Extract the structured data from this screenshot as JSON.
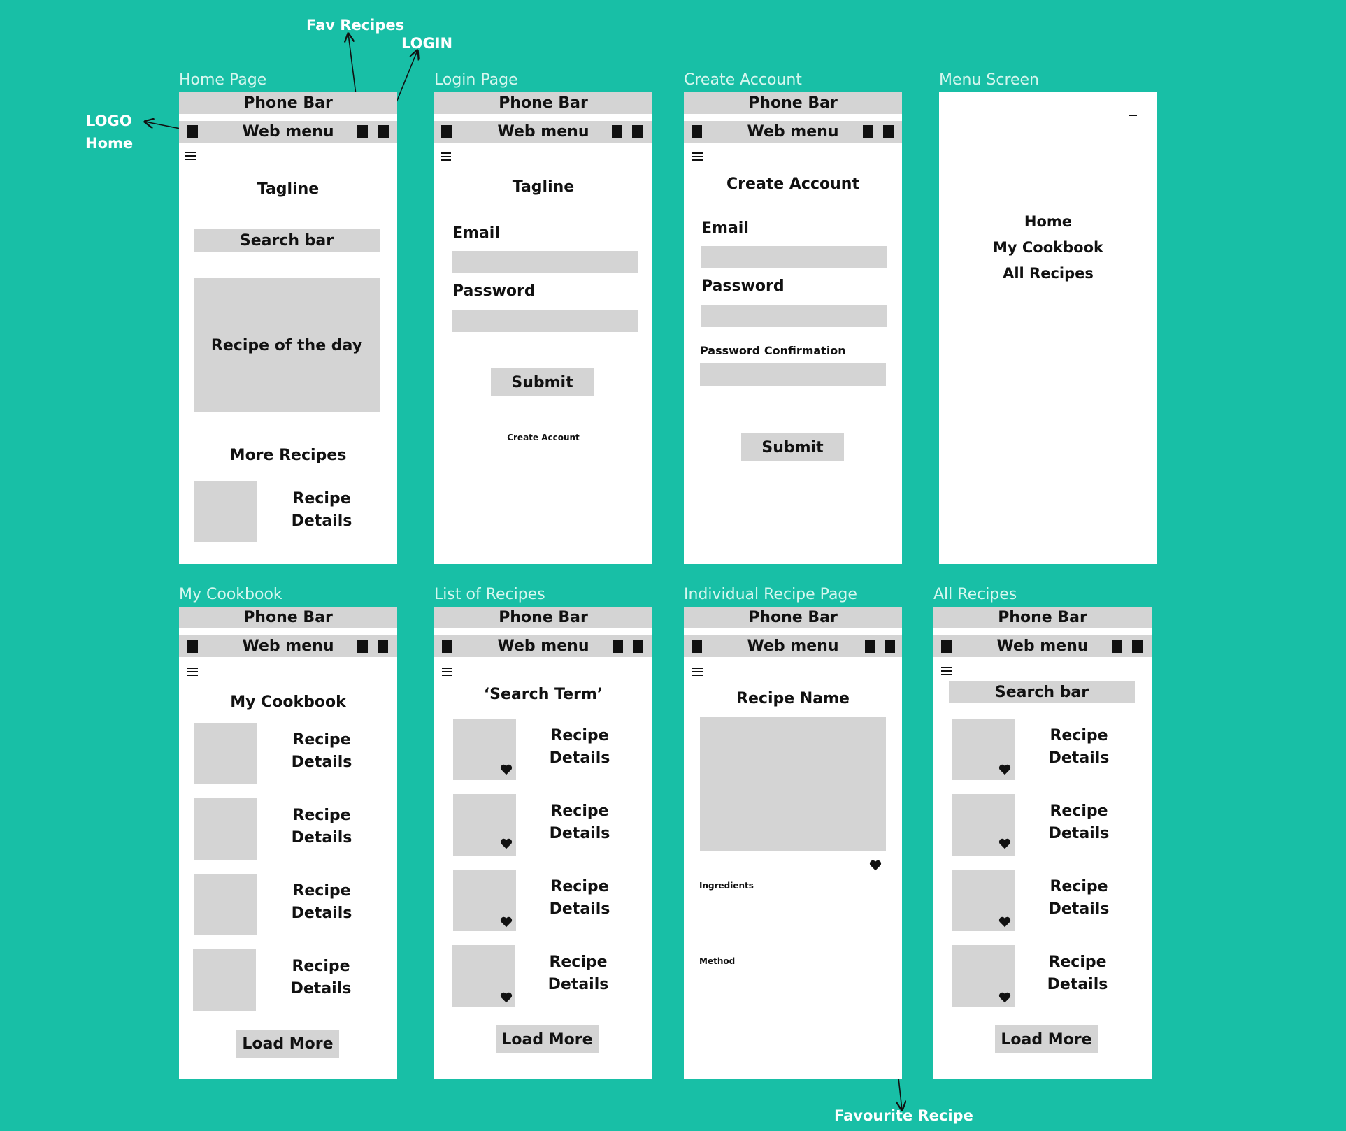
{
  "annotations": {
    "fav_recipes": "Fav Recipes",
    "login": "LOGIN",
    "logo": "LOGO",
    "home": "Home",
    "favourite_recipe": "Favourite Recipe"
  },
  "common": {
    "phone_bar": "Phone Bar",
    "web_menu": "Web menu",
    "recipe": "Recipe",
    "details": "Details",
    "load_more": "Load More",
    "search_bar": "Search bar",
    "tagline": "Tagline",
    "email": "Email",
    "password": "Password",
    "submit": "Submit"
  },
  "home_page": {
    "title": "Home Page",
    "recipe_of_the_day": "Recipe of the day",
    "more_recipes": "More Recipes"
  },
  "login_page": {
    "title": "Login Page",
    "create_account_link": "Create Account"
  },
  "create_account": {
    "title": "Create Account",
    "heading": "Create Account",
    "password_confirmation": "Password Confirmation"
  },
  "menu_screen": {
    "title": "Menu Screen",
    "items": [
      "Home",
      "My Cookbook",
      "All Recipes"
    ]
  },
  "my_cookbook": {
    "title": "My Cookbook",
    "heading": "My Cookbook"
  },
  "list_of_recipes": {
    "title": "List of Recipes",
    "heading": "‘Search Term’"
  },
  "individual_recipe": {
    "title": "Individual Recipe Page",
    "heading": "Recipe Name",
    "ingredients": "Ingredients",
    "method": "Method"
  },
  "all_recipes": {
    "title": "All Recipes"
  },
  "colors": {
    "background": "#18BFA6",
    "placeholder_grey": "#D4D4D4",
    "frame": "#FFFFFF"
  }
}
